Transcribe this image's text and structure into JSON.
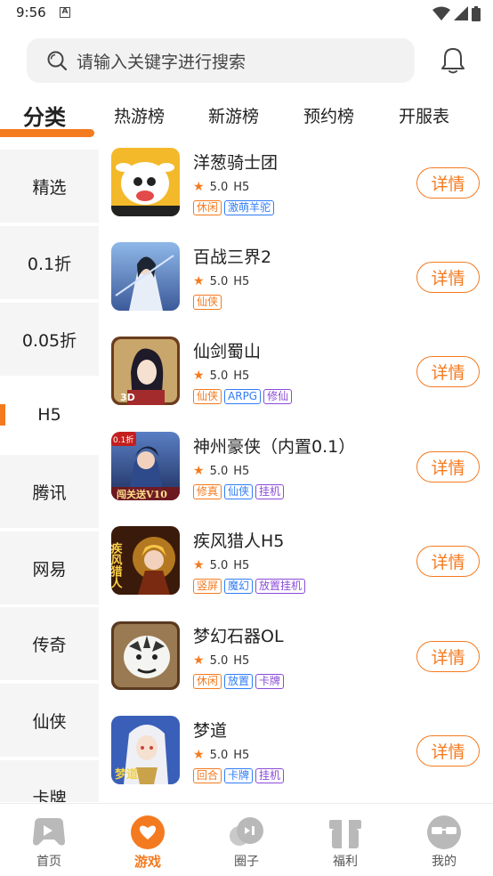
{
  "status_bar": {
    "time": "9:56",
    "notif_glyph": "A"
  },
  "search": {
    "placeholder": "请输入关键字进行搜索"
  },
  "tabs": [
    {
      "label": "分类",
      "active": true
    },
    {
      "label": "热游榜"
    },
    {
      "label": "新游榜"
    },
    {
      "label": "预约榜"
    },
    {
      "label": "开服表"
    }
  ],
  "sidebar": {
    "items": [
      "精选",
      "0.1折",
      "0.05折",
      "H5",
      "腾讯",
      "网易",
      "传奇",
      "仙侠",
      "卡牌"
    ],
    "active_index": 3
  },
  "games": [
    {
      "name": "洋葱骑士团",
      "rating": "5.0",
      "type": "H5",
      "tags": [
        {
          "t": "休闲",
          "c": "orange"
        },
        {
          "t": "激萌羊驼",
          "c": "blue"
        }
      ],
      "detail": "详情"
    },
    {
      "name": "百战三界2",
      "rating": "5.0",
      "type": "H5",
      "tags": [
        {
          "t": "仙侠",
          "c": "orange"
        }
      ],
      "detail": "详情"
    },
    {
      "name": "仙剑蜀山",
      "rating": "5.0",
      "type": "H5",
      "tags": [
        {
          "t": "仙侠",
          "c": "orange"
        },
        {
          "t": "ARPG",
          "c": "blue"
        },
        {
          "t": "修仙",
          "c": "purple"
        }
      ],
      "detail": "详情",
      "badge": "3D"
    },
    {
      "name": "神州豪侠（内置0.1）",
      "rating": "5.0",
      "type": "H5",
      "tags": [
        {
          "t": "修真",
          "c": "orange"
        },
        {
          "t": "仙侠",
          "c": "blue"
        },
        {
          "t": "挂机",
          "c": "purple"
        }
      ],
      "detail": "详情",
      "badge": "0.1折",
      "banner": "闯关送V10"
    },
    {
      "name": "疾风猎人H5",
      "rating": "5.0",
      "type": "H5",
      "tags": [
        {
          "t": "竖屏",
          "c": "orange"
        },
        {
          "t": "魔幻",
          "c": "blue"
        },
        {
          "t": "放置挂机",
          "c": "purple"
        }
      ],
      "detail": "详情",
      "banner": "疾风猎人"
    },
    {
      "name": "梦幻石器OL",
      "rating": "5.0",
      "type": "H5",
      "tags": [
        {
          "t": "休闲",
          "c": "orange"
        },
        {
          "t": "放置",
          "c": "blue"
        },
        {
          "t": "卡牌",
          "c": "purple"
        }
      ],
      "detail": "详情"
    },
    {
      "name": "梦道",
      "rating": "5.0",
      "type": "H5",
      "tags": [
        {
          "t": "回合",
          "c": "orange"
        },
        {
          "t": "卡牌",
          "c": "blue"
        },
        {
          "t": "挂机",
          "c": "purple"
        }
      ],
      "detail": "详情",
      "banner": "梦道"
    }
  ],
  "bottom_nav": [
    {
      "label": "首页",
      "icon": "gamepad-icon"
    },
    {
      "label": "游戏",
      "icon": "heart-chat-icon",
      "active": true
    },
    {
      "label": "圈子",
      "icon": "chat-bubbles-icon"
    },
    {
      "label": "福利",
      "icon": "gift-icon"
    },
    {
      "label": "我的",
      "icon": "sunglasses-face-icon"
    }
  ],
  "colors": {
    "accent": "#f47a1f",
    "tag_blue": "#2f7df6",
    "tag_purple": "#8a4bd8",
    "sidebar_bg": "#f5f5f5"
  }
}
